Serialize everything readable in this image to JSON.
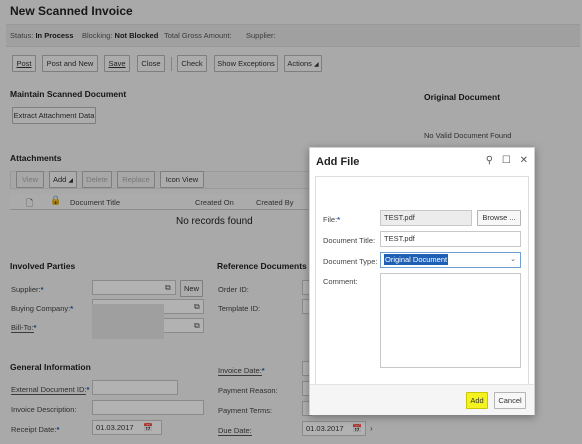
{
  "page": {
    "title": "New Scanned Invoice",
    "status": {
      "status_label": "Status:",
      "status_value": "In Process",
      "blocking_label": "Blocking:",
      "blocking_value": "Not Blocked",
      "gross_label": "Total Gross Amount:",
      "supplier_label": "Supplier:"
    }
  },
  "toolbar": {
    "post": "Post",
    "post_and_new": "Post and New",
    "save": "Save",
    "close": "Close",
    "check": "Check",
    "show_exceptions": "Show Exceptions",
    "actions": "Actions"
  },
  "maintain": {
    "heading": "Maintain Scanned Document",
    "extract_button": "Extract Attachment Data"
  },
  "original": {
    "heading": "Original Document",
    "message": "No Valid Document Found"
  },
  "attachments": {
    "heading": "Attachments",
    "toolbar": {
      "view": "View",
      "add": "Add",
      "delete": "Delete",
      "replace": "Replace",
      "icon_view": "Icon View"
    },
    "columns": {
      "title": "Document Title",
      "created_on": "Created On",
      "created_by": "Created By"
    },
    "empty": "No records found"
  },
  "parties": {
    "heading": "Involved Parties",
    "supplier": "Supplier:",
    "buying_company": "Buying Company:",
    "bill_to": "Bill-To:",
    "new_button": "New"
  },
  "reference": {
    "heading": "Reference Documents",
    "order_id": "Order ID:",
    "template_id": "Template ID:"
  },
  "general": {
    "heading": "General Information",
    "external_doc_id": "External Document ID:",
    "invoice_description": "Invoice Description:",
    "receipt_date": "Receipt Date:",
    "receipt_date_value": "01.03.2017",
    "invoice_date": "Invoice Date:",
    "payment_reason": "Payment Reason:",
    "payment_terms": "Payment Terms:",
    "due_date": "Due Date:",
    "due_date_value": "01.03.2017"
  },
  "dialog": {
    "title": "Add File",
    "file_label": "File:",
    "file_value": "TEST.pdf",
    "browse": "Browse ...",
    "doc_title_label": "Document Title:",
    "doc_title_value": "TEST.pdf",
    "doc_type_label": "Document Type:",
    "doc_type_value": "Original Document",
    "comment_label": "Comment:",
    "add": "Add",
    "cancel": "Cancel"
  },
  "colors": {
    "accent": "#1f5fb4",
    "highlight": "#f5f31f"
  }
}
